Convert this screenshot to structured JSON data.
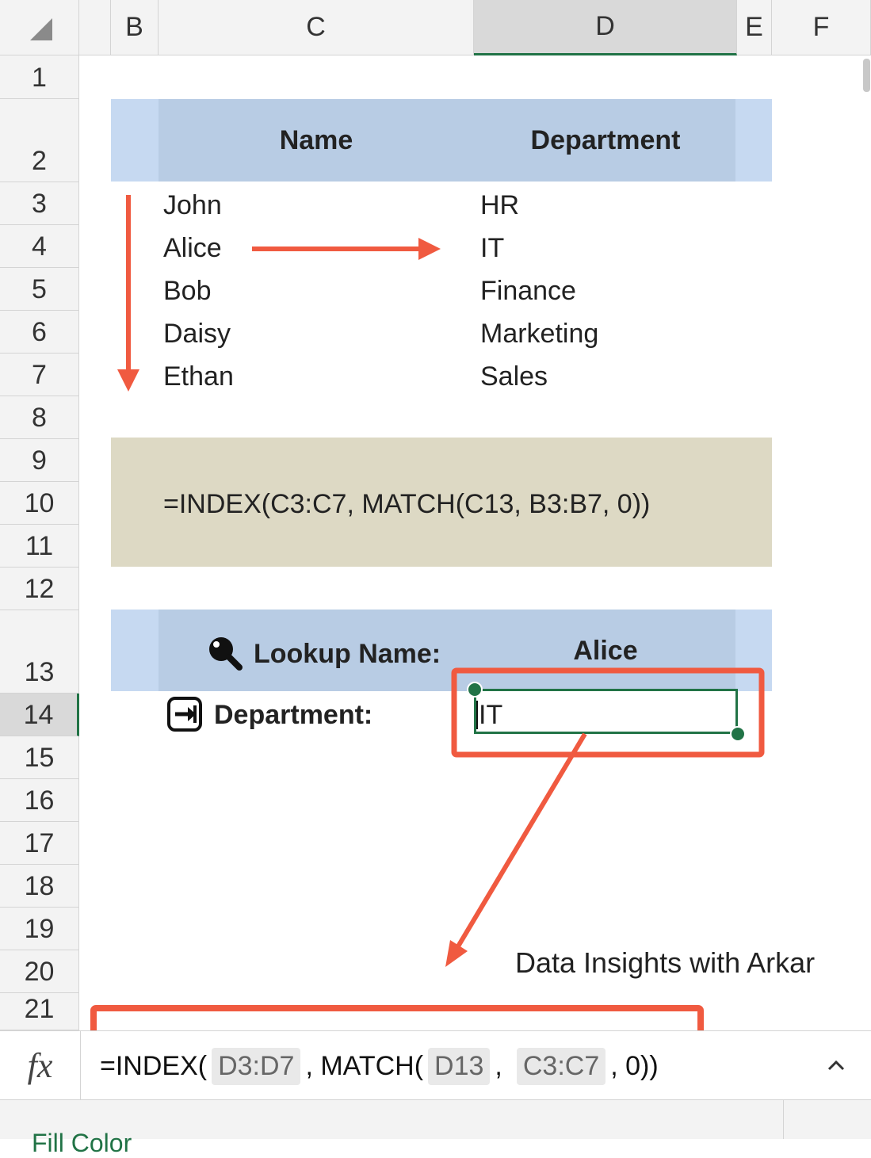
{
  "corner_label": "",
  "columns": [
    "B",
    "C",
    "D",
    "E",
    "F"
  ],
  "rows": [
    "1",
    "2",
    "3",
    "4",
    "5",
    "6",
    "7",
    "8",
    "9",
    "10",
    "11",
    "12",
    "13",
    "14",
    "15",
    "16",
    "17",
    "18",
    "19",
    "20",
    "21"
  ],
  "table": {
    "header_name": "Name",
    "header_department": "Department",
    "entries": [
      {
        "name": "John",
        "department": "HR"
      },
      {
        "name": "Alice",
        "department": "IT"
      },
      {
        "name": "Bob",
        "department": "Finance"
      },
      {
        "name": "Daisy",
        "department": "Marketing"
      },
      {
        "name": "Ethan",
        "department": "Sales"
      }
    ]
  },
  "formula_box": "=INDEX(C3:C7, MATCH(C13, B3:B7, 0))",
  "lookup": {
    "label": "Lookup Name:",
    "value": "Alice",
    "result_label": "Department:",
    "result_value": "IT"
  },
  "watermark": "Data Insights with Arkar",
  "formula_bar": {
    "fx_label": "fx",
    "part1": "=INDEX(",
    "ref1": "D3:D7",
    "part2": ", MATCH(",
    "ref2": "D13",
    "part3": ",",
    "ref3": "C3:C7",
    "part4": ", 0))",
    "expand_icon": "chevron-up-icon"
  },
  "bottom_partial_text": "Fill Color",
  "colors": {
    "accent_green": "#217346",
    "annotation_red": "#f05a40",
    "header_blue": "#b8cce4",
    "formula_bg": "#ddd9c4"
  }
}
